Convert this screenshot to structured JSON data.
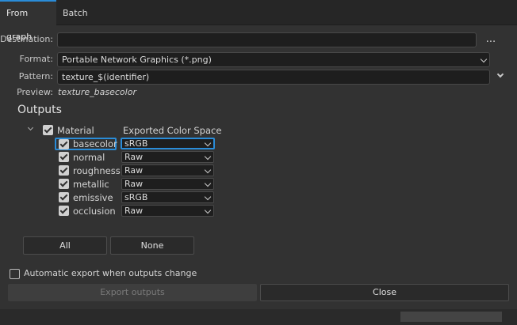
{
  "tabs": [
    {
      "label": "From graph"
    },
    {
      "label": "Batch"
    }
  ],
  "form": {
    "destination_label": "Destination:",
    "destination_value": "",
    "browse_label": "...",
    "format_label": "Format:",
    "format_value": "Portable Network Graphics (*.png)",
    "pattern_label": "Pattern:",
    "pattern_value": "texture_$(identifier)",
    "preview_label": "Preview:",
    "preview_value": "texture_basecolor"
  },
  "outputs": {
    "heading": "Outputs",
    "group_label": "Material",
    "column_header": "Exported Color Space",
    "rows": [
      {
        "name": "basecolor",
        "color_space": "sRGB",
        "checked": true
      },
      {
        "name": "normal",
        "color_space": "Raw",
        "checked": true
      },
      {
        "name": "roughness",
        "color_space": "Raw",
        "checked": true
      },
      {
        "name": "metallic",
        "color_space": "Raw",
        "checked": true
      },
      {
        "name": "emissive",
        "color_space": "sRGB",
        "checked": true
      },
      {
        "name": "occlusion",
        "color_space": "Raw",
        "checked": true
      }
    ],
    "all_button": "All",
    "none_button": "None"
  },
  "auto_export": {
    "label": "Automatic export when outputs change",
    "checked": false
  },
  "footer": {
    "export_button": "Export outputs",
    "close_button": "Close"
  },
  "colors": {
    "accent": "#2a8cd8",
    "background": "#323232",
    "field": "#1e1e1e"
  }
}
